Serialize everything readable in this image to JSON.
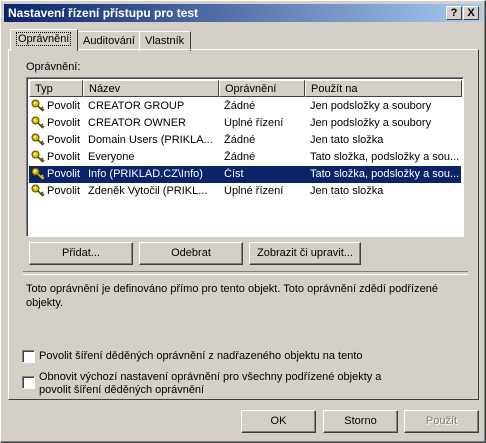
{
  "window": {
    "title": "Nastavení řízení přístupu pro test",
    "help_btn": "?",
    "close_btn": "X"
  },
  "tabs": [
    {
      "label": "Oprávnění"
    },
    {
      "label": "Auditování"
    },
    {
      "label": "Vlastník"
    }
  ],
  "permissions_label": "Oprávnění:",
  "columns": [
    "Typ",
    "Název",
    "Oprávnění",
    "Použít na"
  ],
  "rows": [
    {
      "type": "Povolit",
      "name": "CREATOR GROUP",
      "perm": "Žádné",
      "apply": "Jen podsložky a soubory"
    },
    {
      "type": "Povolit",
      "name": "CREATOR OWNER",
      "perm": "Úplné řízení",
      "apply": "Jen podsložky a soubory"
    },
    {
      "type": "Povolit",
      "name": "Domain Users (PRIKLA...",
      "perm": "Žádné",
      "apply": "Jen tato složka"
    },
    {
      "type": "Povolit",
      "name": "Everyone",
      "perm": "Žádné",
      "apply": "Tato složka, podsložky a sou..."
    },
    {
      "type": "Povolit",
      "name": "Info (PRIKLAD.CZ\\Info)",
      "perm": "Číst",
      "apply": "Tato složka, podsložky a sou..."
    },
    {
      "type": "Povolit",
      "name": "Zdeněk Vytočil (PRIKL...",
      "perm": "Úplné řízení",
      "apply": "Jen tato složka"
    }
  ],
  "buttons": {
    "add": "Přidat...",
    "remove": "Odebrat",
    "view": "Zobrazit či upravit..."
  },
  "info_text": "Toto oprávnění je definováno přímo pro tento objekt. Toto oprávnění zdědí podřízené objekty.",
  "checkboxes": {
    "inherit": "Povolit šíření děděných oprávnění z nadřazeného objektu na tento",
    "reset_line1": "Obnovit výchozí nastavení oprávnění pro všechny podřízené objekty a",
    "reset_line2": "povolit šíření děděných oprávnění"
  },
  "footer": {
    "ok": "OK",
    "cancel": "Storno",
    "apply": "Použít"
  },
  "colors": {
    "title_bar": "#0a246a",
    "selection": "#0a246a",
    "face": "#d4d0c8",
    "key_icon": "#b8a000"
  }
}
